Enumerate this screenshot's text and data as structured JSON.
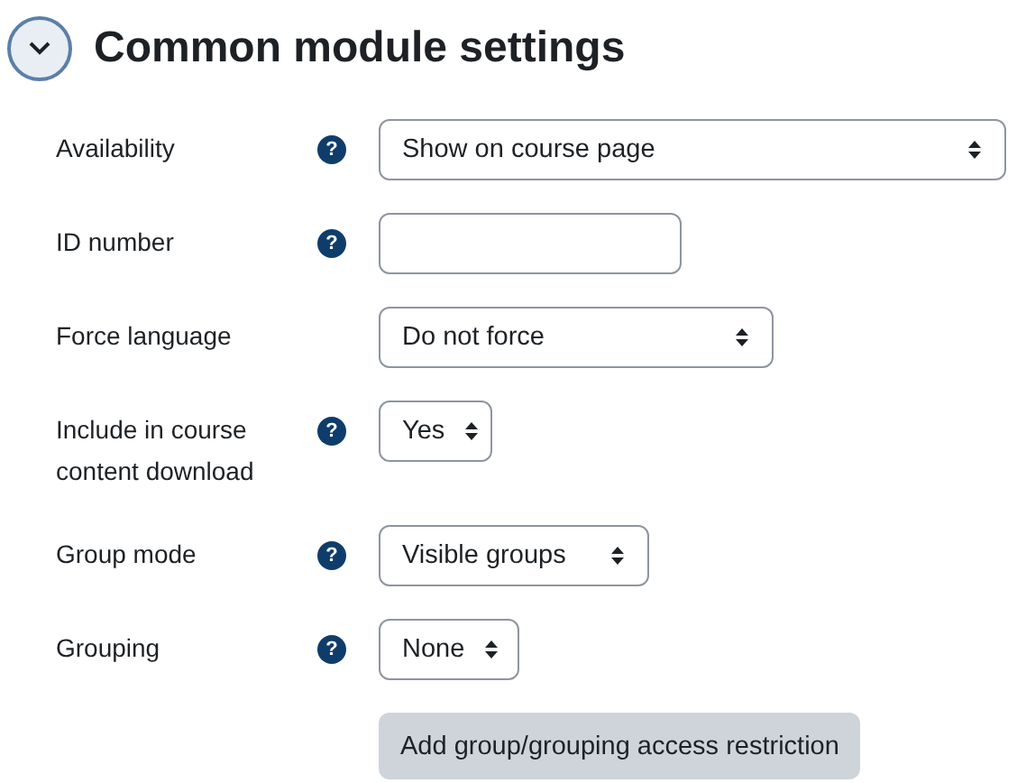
{
  "section": {
    "title": "Common module settings",
    "expanded": true
  },
  "fields": [
    {
      "label": "Availability",
      "help": "?",
      "kind": "select",
      "value": "Show on course page"
    },
    {
      "label": "ID number",
      "help": "?",
      "kind": "text"
    },
    {
      "label": "Force language",
      "kind": "select",
      "value": "Do not force"
    },
    {
      "label": "Include in course content download",
      "help": "?",
      "kind": "select",
      "value": "Yes"
    },
    {
      "label": "Group mode",
      "help": "?",
      "kind": "select",
      "value": "Visible groups"
    },
    {
      "label": "Grouping",
      "help": "?",
      "kind": "select",
      "value": "None"
    }
  ],
  "action_button": "Add group/grouping access restriction"
}
